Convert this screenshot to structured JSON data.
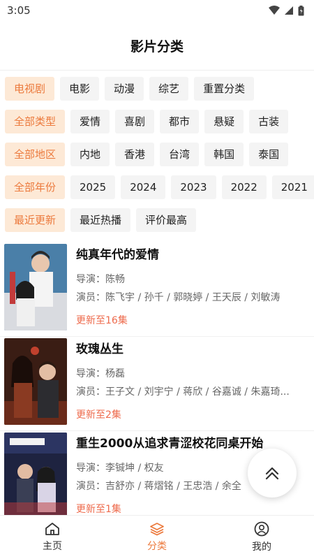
{
  "status_bar": {
    "time": "3:05"
  },
  "header": {
    "title": "影片分类"
  },
  "filters": {
    "channel": [
      {
        "label": "电视剧",
        "active": true
      },
      {
        "label": "电影",
        "active": false
      },
      {
        "label": "动漫",
        "active": false
      },
      {
        "label": "综艺",
        "active": false
      },
      {
        "label": "重置分类",
        "active": false
      }
    ],
    "genre": [
      {
        "label": "全部类型",
        "active": true
      },
      {
        "label": "爱情",
        "active": false
      },
      {
        "label": "喜剧",
        "active": false
      },
      {
        "label": "都市",
        "active": false
      },
      {
        "label": "悬疑",
        "active": false
      },
      {
        "label": "古装",
        "active": false
      }
    ],
    "region": [
      {
        "label": "全部地区",
        "active": true
      },
      {
        "label": "内地",
        "active": false
      },
      {
        "label": "香港",
        "active": false
      },
      {
        "label": "台湾",
        "active": false
      },
      {
        "label": "韩国",
        "active": false
      },
      {
        "label": "泰国",
        "active": false
      }
    ],
    "year": [
      {
        "label": "全部年份",
        "active": true
      },
      {
        "label": "2025",
        "active": false
      },
      {
        "label": "2024",
        "active": false
      },
      {
        "label": "2023",
        "active": false
      },
      {
        "label": "2022",
        "active": false
      },
      {
        "label": "2021",
        "active": false
      }
    ],
    "sort": [
      {
        "label": "最近更新",
        "active": true
      },
      {
        "label": "最近热播",
        "active": false
      },
      {
        "label": "评价最高",
        "active": false
      }
    ]
  },
  "movies": [
    {
      "title": "纯真年代的爱情",
      "director": "导演：陈畅",
      "actors": "演员：陈飞宇 / 孙千 / 郭晓婷 / 王天辰 / 刘敏涛",
      "update": "更新至16集"
    },
    {
      "title": "玫瑰丛生",
      "director": "导演：杨磊",
      "actors": "演员：王子文 / 刘宇宁 / 蒋欣 / 谷嘉诚 / 朱嘉琦...",
      "update": "更新至2集"
    },
    {
      "title": "重生2000从追求青涩校花同桌开始",
      "director": "导演：李铖坤 / 权友",
      "actors": "演员：吉舒亦 / 蒋熠铭 / 王忠浩 / 余全",
      "update": "更新至1集"
    }
  ],
  "bottom_nav": {
    "home": "主页",
    "category": "分类",
    "mine": "我的"
  },
  "colors": {
    "accent": "#ec7a3d",
    "chip_active_bg": "#fde9d6",
    "update_text": "#ee6b4d"
  }
}
